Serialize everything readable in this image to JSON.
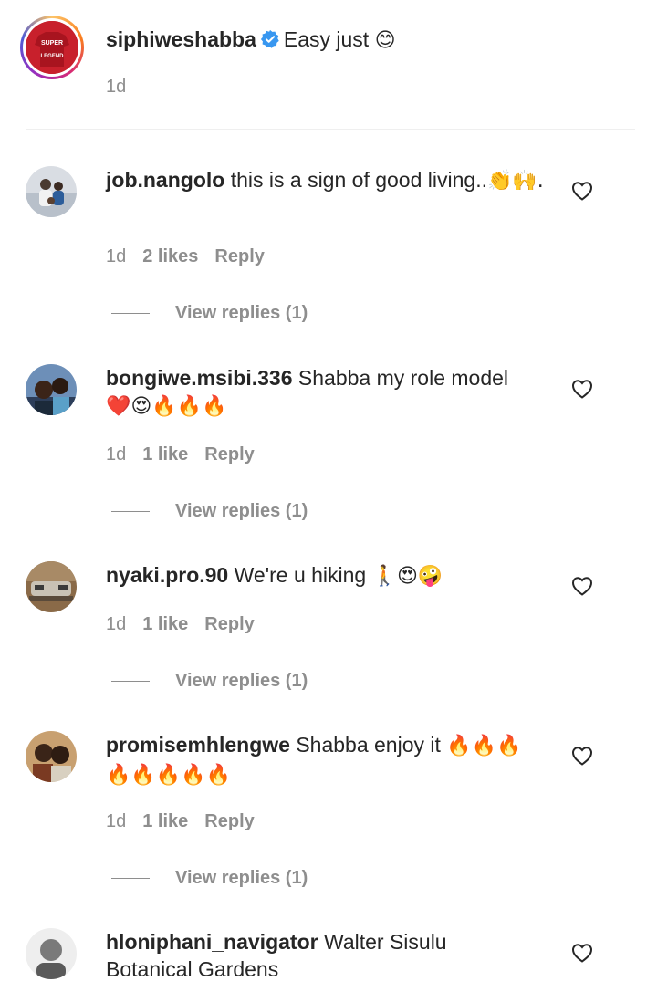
{
  "caption": {
    "username": "siphiweshabba",
    "text": "Easy just",
    "emoji": "😊",
    "time": "1d"
  },
  "comments": [
    {
      "username": "job.nangolo",
      "text": "this is a sign of good living..",
      "emoji": "👏🙌.",
      "time": "1d",
      "likes": "2 likes",
      "reply": "Reply",
      "view_replies": "View replies (1)"
    },
    {
      "username": "bongiwe.msibi.336",
      "text": "Shabba my role model",
      "emoji": "❤️😍🔥🔥🔥",
      "time": "1d",
      "likes": "1 like",
      "reply": "Reply",
      "view_replies": "View replies (1)"
    },
    {
      "username": "nyaki.pro.90",
      "text": "We're u hiking",
      "emoji": "🚶😍🤪",
      "time": "1d",
      "likes": "1 like",
      "reply": "Reply",
      "view_replies": "View replies (1)"
    },
    {
      "username": "promisemhlengwe",
      "text": "Shabba enjoy it",
      "emoji": "🔥🔥🔥🔥🔥🔥🔥🔥",
      "time": "1d",
      "likes": "1 like",
      "reply": "Reply",
      "view_replies": "View replies (1)"
    },
    {
      "username": "hloniphani_navigator",
      "text": "Walter Sisulu Botanical Gardens"
    }
  ],
  "icons": {
    "like": "heart-outline-icon",
    "verified": "verified-badge-icon"
  },
  "colors": {
    "verified": "#3897f0",
    "muted": "#8e8e8e",
    "text": "#262626"
  }
}
